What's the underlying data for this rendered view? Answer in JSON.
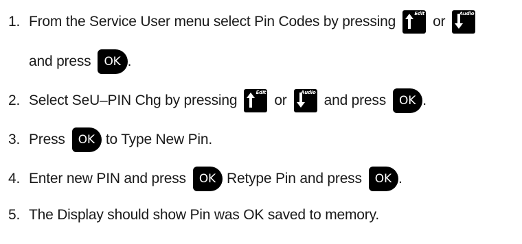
{
  "keys": {
    "edit_label": "Edit",
    "audio_label": "Audio",
    "ok_label": "OK"
  },
  "steps": [
    {
      "number": "1.",
      "text_a": "From the Service User menu select Pin Codes by pressing",
      "text_or": "or",
      "text_b": "and press",
      "text_end": "."
    },
    {
      "number": "2.",
      "text_a": "Select SeU–PIN Chg by pressing",
      "text_or": "or",
      "text_b": "and press",
      "text_end": "."
    },
    {
      "number": "3.",
      "text_a": "Press",
      "text_b": "to Type New Pin."
    },
    {
      "number": "4.",
      "text_a": "Enter new PIN and press",
      "text_b": "Retype Pin and press",
      "text_end": "."
    },
    {
      "number": "5.",
      "text_a": "The Display should show Pin was OK saved to memory."
    }
  ]
}
